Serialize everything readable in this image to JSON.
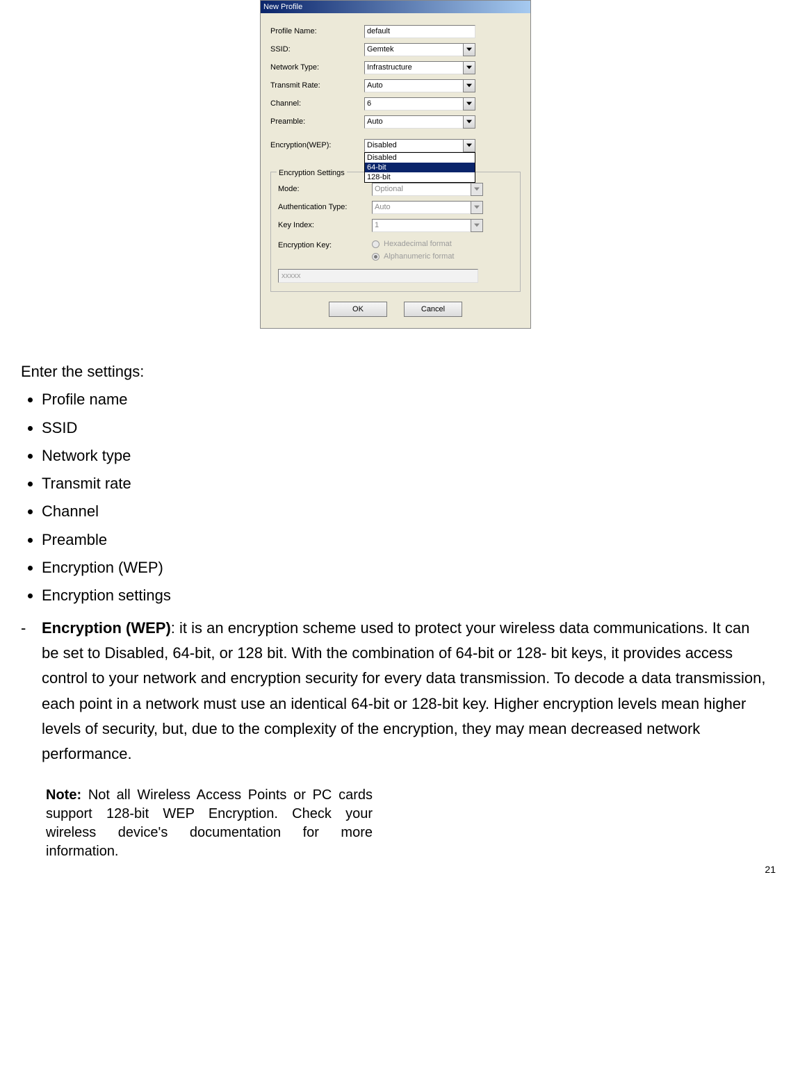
{
  "dialog": {
    "title": "New Profile",
    "fields": {
      "profile_name": {
        "label": "Profile Name:",
        "value": "default"
      },
      "ssid": {
        "label": "SSID:",
        "value": "Gemtek"
      },
      "network_type": {
        "label": "Network Type:",
        "value": "Infrastructure"
      },
      "transmit_rate": {
        "label": "Transmit Rate:",
        "value": "Auto"
      },
      "channel": {
        "label": "Channel:",
        "value": "6"
      },
      "preamble": {
        "label": "Preamble:",
        "value": "Auto"
      },
      "encryption": {
        "label": "Encryption(WEP):",
        "value": "Disabled"
      }
    },
    "encryption_options": [
      "Disabled",
      "64-bit",
      "128-bit"
    ],
    "encryption_selected": "64-bit",
    "enc_settings": {
      "legend": "Encryption Settings",
      "mode": {
        "label": "Mode:",
        "value": "Optional"
      },
      "auth": {
        "label": "Authentication Type:",
        "value": "Auto"
      },
      "key_index": {
        "label": "Key Index:",
        "value": "1"
      },
      "enc_key_label": "Encryption Key:",
      "radio_hex": "Hexadecimal format",
      "radio_alpha": "Alphanumeric format",
      "key_value": "xxxxx"
    },
    "ok_label": "OK",
    "cancel_label": "Cancel"
  },
  "doc": {
    "intro": "Enter the settings:",
    "bullets": [
      "Profile name",
      "SSID",
      "Network type",
      "Transmit rate",
      "Channel",
      "Preamble",
      "Encryption (WEP)",
      "Encryption settings"
    ],
    "wep_title": "Encryption (WEP)",
    "wep_body": ": it is an encryption scheme used to protect your wireless data communications. It can be set to Disabled, 64-bit, or 128 bit. With the combination of 64-bit or 128- bit keys, it provides access control to your network and encryption security for every data transmission. To decode a data transmission, each point in a network must use an identical 64-bit or 128-bit key. Higher encryption levels mean higher levels of security, but, due to the complexity of the encryption, they may mean decreased network performance.",
    "note_label": "Note:",
    "note_body": " Not all Wireless Access Points or PC cards support 128-bit WEP Encryption. Check your wireless device's documentation for more information.",
    "page_number": "21"
  }
}
